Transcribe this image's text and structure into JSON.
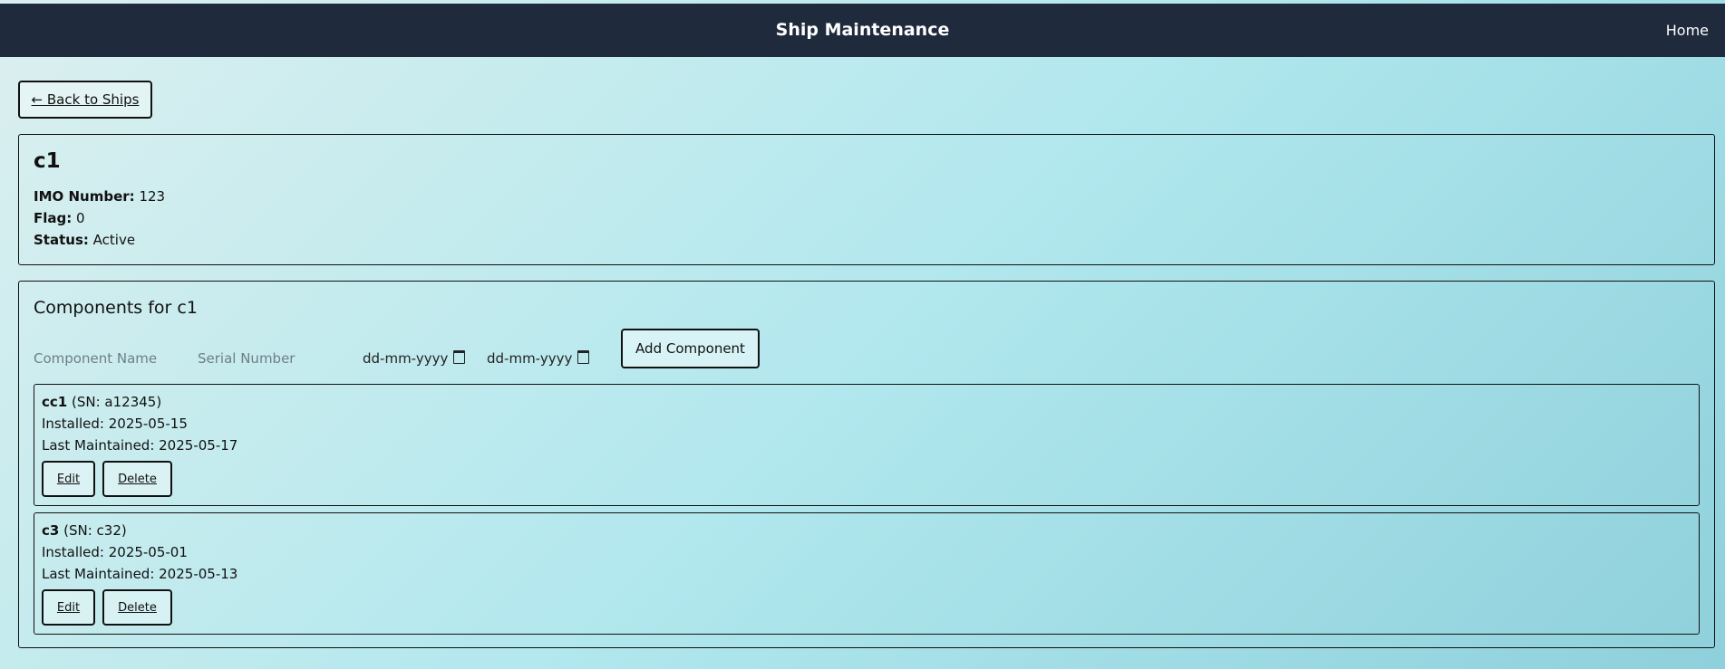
{
  "header": {
    "title": "Ship Maintenance",
    "home_link": "Home",
    "bg_color": "#1f2a3c"
  },
  "back_button": "← Back to Ships",
  "ship": {
    "name": "c1",
    "imo_label": "IMO Number:",
    "imo_value": "123",
    "flag_label": "Flag:",
    "flag_value": "0",
    "status_label": "Status:",
    "status_value": "Active"
  },
  "components": {
    "heading": "Components for c1",
    "form": {
      "name_placeholder": "Component Name",
      "serial_placeholder": "Serial Number",
      "install_date_placeholder": "dd-mm-yyyy",
      "maint_date_placeholder": "dd-mm-yyyy",
      "add_button": "Add Component"
    },
    "items": [
      {
        "name": "cc1",
        "serial": " (SN: a12345)",
        "installed": "Installed: 2025-05-15",
        "last_maintained": "Last Maintained: 2025-05-17",
        "edit": "Edit",
        "delete": "Delete"
      },
      {
        "name": "c3",
        "serial": " (SN: c32)",
        "installed": "Installed: 2025-05-01",
        "last_maintained": "Last Maintained: 2025-05-13",
        "edit": "Edit",
        "delete": "Delete"
      }
    ]
  }
}
